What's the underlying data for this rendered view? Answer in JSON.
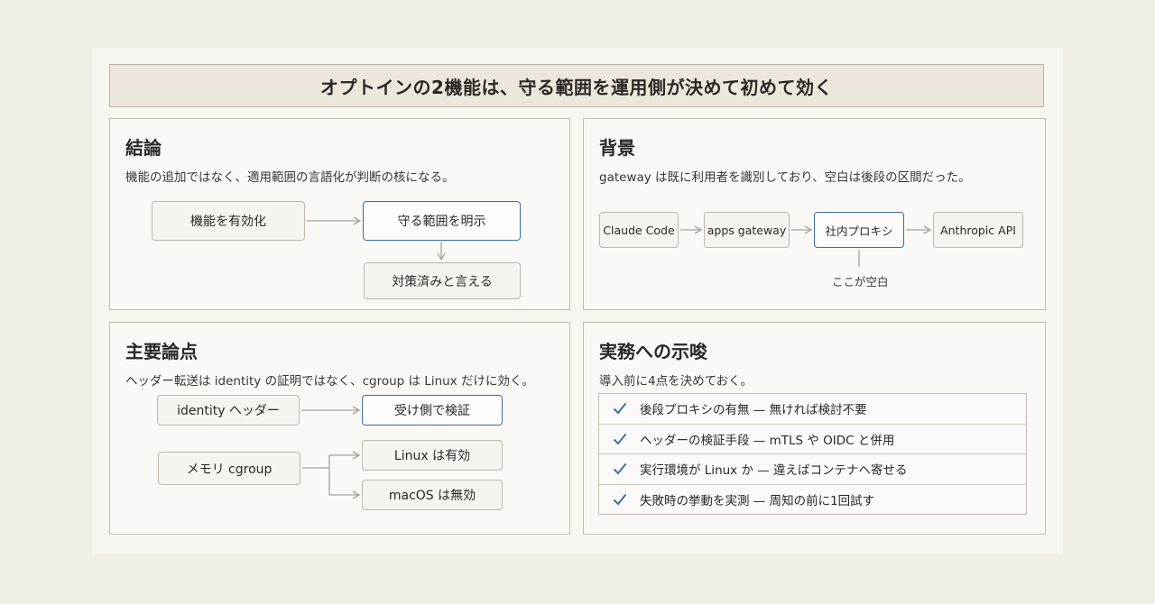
{
  "title": "オプトインの2機能は、守る範囲を運用側が決めて初めて効く",
  "panels": {
    "conclusion": {
      "title": "結論",
      "subtitle": "機能の追加ではなく、適用範囲の言語化が判断の核になる。",
      "nodes": {
        "enable": "機能を有効化",
        "scope": "守る範囲を明示",
        "covered": "対策済みと言える"
      }
    },
    "background": {
      "title": "背景",
      "subtitle": "gateway は既に利用者を識別しており、空白は後段の区間だった。",
      "nodes": {
        "claude": "Claude Code",
        "gateway": "apps gateway",
        "proxy": "社内プロキシ",
        "api": "Anthropic API"
      },
      "note": "ここが空白"
    },
    "points": {
      "title": "主要論点",
      "subtitle": "ヘッダー転送は identity の証明ではなく、cgroup は Linux だけに効く。",
      "nodes": {
        "identity": "identity ヘッダー",
        "verify": "受け側で検証",
        "cgroup": "メモリ cgroup",
        "linux": "Linux は有効",
        "macos": "macOS は無効"
      }
    },
    "practice": {
      "title": "実務への示唆",
      "subtitle": "導入前に4点を決めておく。",
      "checks": [
        "後段プロキシの有無 — 無ければ検討不要",
        "ヘッダーの検証手段 — mTLS や OIDC と併用",
        "実行環境が Linux か — 違えばコンテナへ寄せる",
        "失敗時の挙動を実測 — 周知の前に1回試す"
      ]
    }
  },
  "colors": {
    "accent": "#3d6fa8",
    "border": "#c2bcb2",
    "arrow": "#a9a39a"
  },
  "icons": {
    "check": "check-icon"
  }
}
